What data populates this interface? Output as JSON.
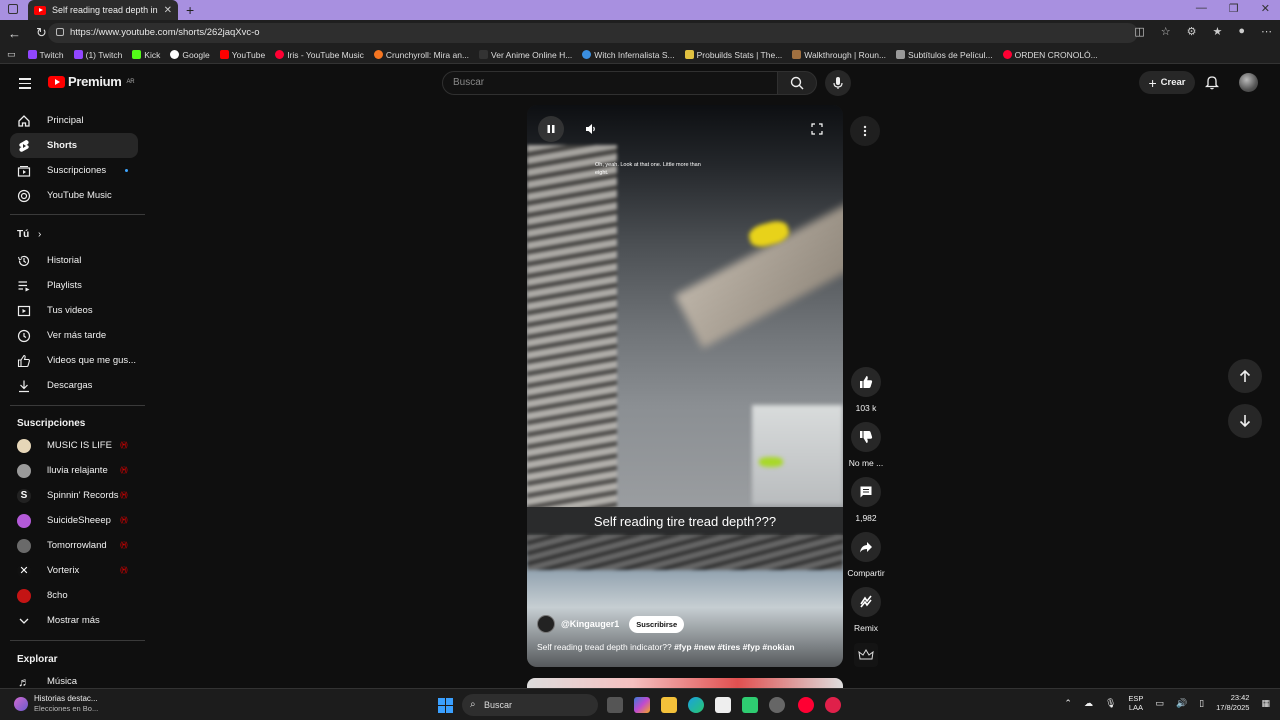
{
  "browser": {
    "tab_title": "Self reading tread depth indic",
    "url": "https://www.youtube.com/shorts/262jaqXvc-o",
    "bookmarks": [
      "Twitch",
      "(1) Twitch",
      "Kick",
      "Google",
      "YouTube",
      "Iris - YouTube Music",
      "Crunchyroll: Mira an...",
      "Ver Anime Online H...",
      "Witch Infernalista S...",
      "Probuilds Stats | The...",
      "Walkthrough | Roun...",
      "Subtítulos de Películ...",
      "ORDEN CRONOLÓ..."
    ]
  },
  "header": {
    "logo_text": "Premium",
    "country": "AR",
    "search_placeholder": "Buscar",
    "create_label": "Crear"
  },
  "sidebar": {
    "main": [
      {
        "label": "Principal",
        "icon": "home-icon"
      },
      {
        "label": "Shorts",
        "icon": "shorts-icon",
        "active": true
      },
      {
        "label": "Suscripciones",
        "icon": "subscriptions-icon"
      },
      {
        "label": "YouTube Music",
        "icon": "music-icon"
      }
    ],
    "you_header": "Tú",
    "you": [
      {
        "label": "Historial",
        "icon": "history-icon"
      },
      {
        "label": "Playlists",
        "icon": "playlist-icon"
      },
      {
        "label": "Tus videos",
        "icon": "your-videos-icon"
      },
      {
        "label": "Ver más tarde",
        "icon": "watch-later-icon"
      },
      {
        "label": "Videos que me gus...",
        "icon": "liked-icon"
      },
      {
        "label": "Descargas",
        "icon": "download-icon"
      }
    ],
    "subs_header": "Suscripciones",
    "subs": [
      {
        "label": "MUSIC IS LIFE",
        "color": "#e6d6b8"
      },
      {
        "label": "lluvia relajante",
        "color": "#9a9a9a"
      },
      {
        "label": "Spinnin' Records",
        "color": "#222222"
      },
      {
        "label": "SuicideSheeep",
        "color": "#b35ad8"
      },
      {
        "label": "Tomorrowland",
        "color": "#6a6a6a"
      },
      {
        "label": "Vorterix",
        "color": "#111111"
      },
      {
        "label": "8cho",
        "color": "#c41414"
      }
    ],
    "show_more": "Mostrar más",
    "explore_header": "Explorar",
    "explore": [
      {
        "label": "Música",
        "icon": "music-note-icon"
      }
    ]
  },
  "short": {
    "subtitle": "Oh, yeah. Look at that one. Little more than eight.",
    "caption": "Self reading tire tread depth???",
    "channel": "@Kingauger1",
    "subscribe_label": "Suscribirse",
    "description": "Self reading tread depth indicator??",
    "hashtags": "#fyp #new #tires #fyp #nokian"
  },
  "actions": {
    "like_count": "103 k",
    "dislike_label": "No me ...",
    "comments_count": "1,982",
    "share_label": "Compartir",
    "remix_label": "Remix"
  },
  "taskbar": {
    "news_title": "Historias destac...",
    "news_sub": "Elecciones en Bo...",
    "search_label": "Buscar",
    "lang_top": "ESP",
    "lang_bottom": "LAA",
    "time": "23:42",
    "date": "17/8/2025"
  }
}
